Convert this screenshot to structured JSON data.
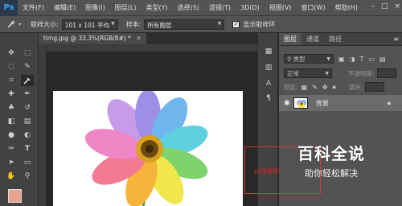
{
  "menubar": {
    "logo": "Ps",
    "items": [
      "文件(F)",
      "编辑(E)",
      "图像(I)",
      "图层(L)",
      "类型(Y)",
      "选择(S)",
      "滤镜(T)",
      "3D(D)",
      "视图(V)",
      "窗口(W)",
      "帮助(H)"
    ],
    "controls": [
      "–",
      "□",
      "×"
    ]
  },
  "options": {
    "tool_icon": "eyedropper-icon",
    "sample_size_label": "取样大小:",
    "sample_size_value": "101 x 101 平均",
    "sample_label": "样本:",
    "sample_value": "所有图层",
    "show_ring_label": "显示取样环",
    "show_ring_checked": true
  },
  "document": {
    "tab_title": "timg.jpg @ 33.3%(RGB/8#) *",
    "close": "×"
  },
  "colors": {
    "foreground": "#e9a28c",
    "background": "#ffffff"
  },
  "layers_panel": {
    "tabs": [
      "图层",
      "通道",
      "路径"
    ],
    "filter_value": "类型",
    "blend_mode": "正常",
    "opacity_label": "不透明度:",
    "lock_label": "锁定:",
    "fill_label": "填充:",
    "layer_name": "背景"
  },
  "annotation": {
    "text": "ps吸管取"
  },
  "watermark": {
    "title": "百科全说",
    "subtitle": "助你轻松解决"
  }
}
